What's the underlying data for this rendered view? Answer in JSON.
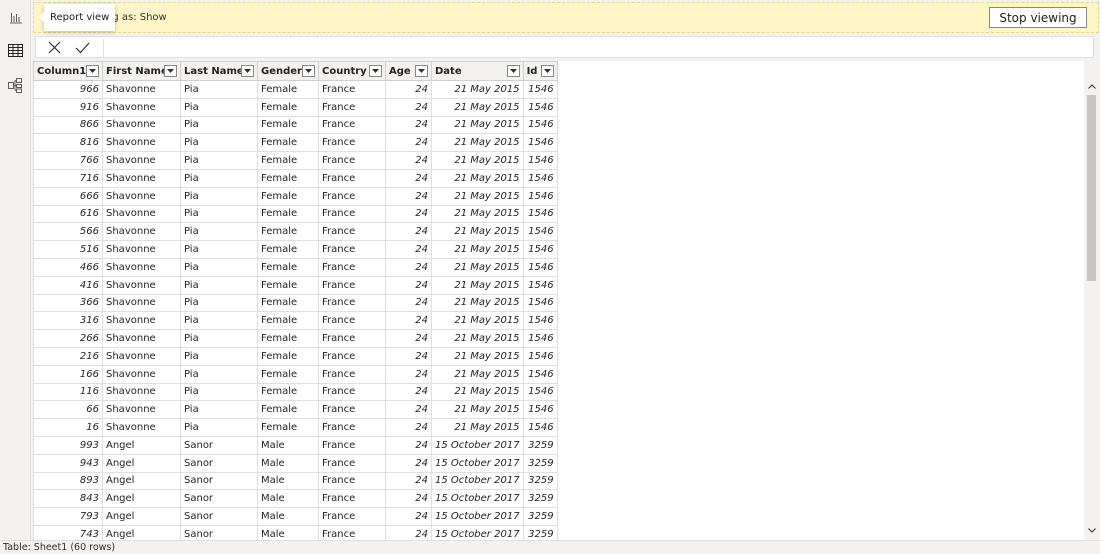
{
  "tooltip": {
    "text": "Report view"
  },
  "banner": {
    "text": "ng as: Show",
    "stop_label": "Stop viewing"
  },
  "rail": {
    "icons": [
      "report-view-icon",
      "data-view-icon",
      "model-view-icon"
    ]
  },
  "formula_bar": {
    "cancel_icon": "close-icon",
    "commit_icon": "check-icon"
  },
  "table": {
    "columns": [
      {
        "label": "Column1",
        "align": "num"
      },
      {
        "label": "First Name",
        "align": "txt"
      },
      {
        "label": "Last Name",
        "align": "txt"
      },
      {
        "label": "Gender",
        "align": "txt"
      },
      {
        "label": "Country",
        "align": "txt"
      },
      {
        "label": "Age",
        "align": "num"
      },
      {
        "label": "Date",
        "align": "num"
      },
      {
        "label": "Id",
        "align": "num"
      }
    ],
    "rows": [
      [
        "966",
        "Shavonne",
        "Pia",
        "Female",
        "France",
        "24",
        "21 May 2015",
        "1546"
      ],
      [
        "916",
        "Shavonne",
        "Pia",
        "Female",
        "France",
        "24",
        "21 May 2015",
        "1546"
      ],
      [
        "866",
        "Shavonne",
        "Pia",
        "Female",
        "France",
        "24",
        "21 May 2015",
        "1546"
      ],
      [
        "816",
        "Shavonne",
        "Pia",
        "Female",
        "France",
        "24",
        "21 May 2015",
        "1546"
      ],
      [
        "766",
        "Shavonne",
        "Pia",
        "Female",
        "France",
        "24",
        "21 May 2015",
        "1546"
      ],
      [
        "716",
        "Shavonne",
        "Pia",
        "Female",
        "France",
        "24",
        "21 May 2015",
        "1546"
      ],
      [
        "666",
        "Shavonne",
        "Pia",
        "Female",
        "France",
        "24",
        "21 May 2015",
        "1546"
      ],
      [
        "616",
        "Shavonne",
        "Pia",
        "Female",
        "France",
        "24",
        "21 May 2015",
        "1546"
      ],
      [
        "566",
        "Shavonne",
        "Pia",
        "Female",
        "France",
        "24",
        "21 May 2015",
        "1546"
      ],
      [
        "516",
        "Shavonne",
        "Pia",
        "Female",
        "France",
        "24",
        "21 May 2015",
        "1546"
      ],
      [
        "466",
        "Shavonne",
        "Pia",
        "Female",
        "France",
        "24",
        "21 May 2015",
        "1546"
      ],
      [
        "416",
        "Shavonne",
        "Pia",
        "Female",
        "France",
        "24",
        "21 May 2015",
        "1546"
      ],
      [
        "366",
        "Shavonne",
        "Pia",
        "Female",
        "France",
        "24",
        "21 May 2015",
        "1546"
      ],
      [
        "316",
        "Shavonne",
        "Pia",
        "Female",
        "France",
        "24",
        "21 May 2015",
        "1546"
      ],
      [
        "266",
        "Shavonne",
        "Pia",
        "Female",
        "France",
        "24",
        "21 May 2015",
        "1546"
      ],
      [
        "216",
        "Shavonne",
        "Pia",
        "Female",
        "France",
        "24",
        "21 May 2015",
        "1546"
      ],
      [
        "166",
        "Shavonne",
        "Pia",
        "Female",
        "France",
        "24",
        "21 May 2015",
        "1546"
      ],
      [
        "116",
        "Shavonne",
        "Pia",
        "Female",
        "France",
        "24",
        "21 May 2015",
        "1546"
      ],
      [
        "66",
        "Shavonne",
        "Pia",
        "Female",
        "France",
        "24",
        "21 May 2015",
        "1546"
      ],
      [
        "16",
        "Shavonne",
        "Pia",
        "Female",
        "France",
        "24",
        "21 May 2015",
        "1546"
      ],
      [
        "993",
        "Angel",
        "Sanor",
        "Male",
        "France",
        "24",
        "15 October 2017",
        "3259"
      ],
      [
        "943",
        "Angel",
        "Sanor",
        "Male",
        "France",
        "24",
        "15 October 2017",
        "3259"
      ],
      [
        "893",
        "Angel",
        "Sanor",
        "Male",
        "France",
        "24",
        "15 October 2017",
        "3259"
      ],
      [
        "843",
        "Angel",
        "Sanor",
        "Male",
        "France",
        "24",
        "15 October 2017",
        "3259"
      ],
      [
        "793",
        "Angel",
        "Sanor",
        "Male",
        "France",
        "24",
        "15 October 2017",
        "3259"
      ],
      [
        "743",
        "Angel",
        "Sanor",
        "Male",
        "France",
        "24",
        "15 October 2017",
        "3259"
      ]
    ]
  },
  "status": {
    "text": "Table: Sheet1 (60 rows)"
  },
  "colors": {
    "banner_bg": "#fef6c6",
    "header_bg": "#f3f2f1",
    "grid_line": "#e1dfdd"
  }
}
